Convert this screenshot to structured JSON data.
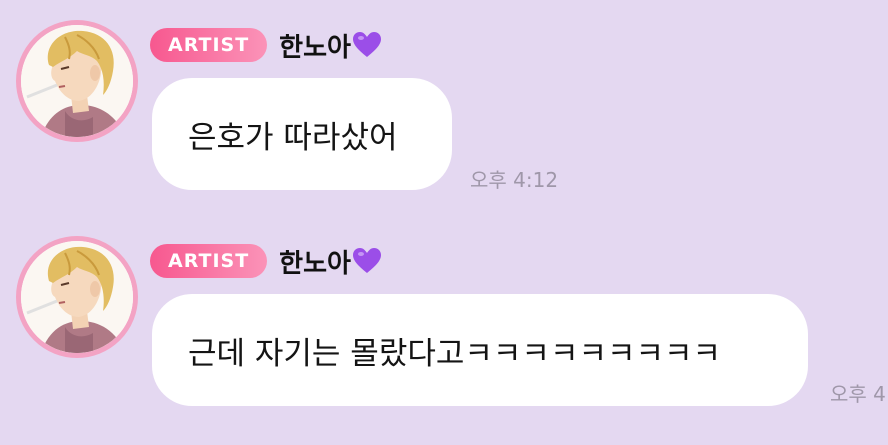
{
  "messages": [
    {
      "badge": "ARTIST",
      "name": "한노아",
      "name_emoji": "purple-heart-icon",
      "text": "은호가 따라샀어",
      "time": "오후 4:12"
    },
    {
      "badge": "ARTIST",
      "name": "한노아",
      "name_emoji": "purple-heart-icon",
      "text": "근데 자기는 몰랐다고ㅋㅋㅋㅋㅋㅋㅋㅋㅋ",
      "time": "오후 4"
    }
  ],
  "colors": {
    "background": "#e4d8f1",
    "badge_start": "#f7588f",
    "badge_end": "#fb93b8",
    "avatar_ring": "#f3a3c4",
    "bubble": "#ffffff",
    "timestamp": "#9f97a9",
    "heart": "#9b4ee8"
  }
}
